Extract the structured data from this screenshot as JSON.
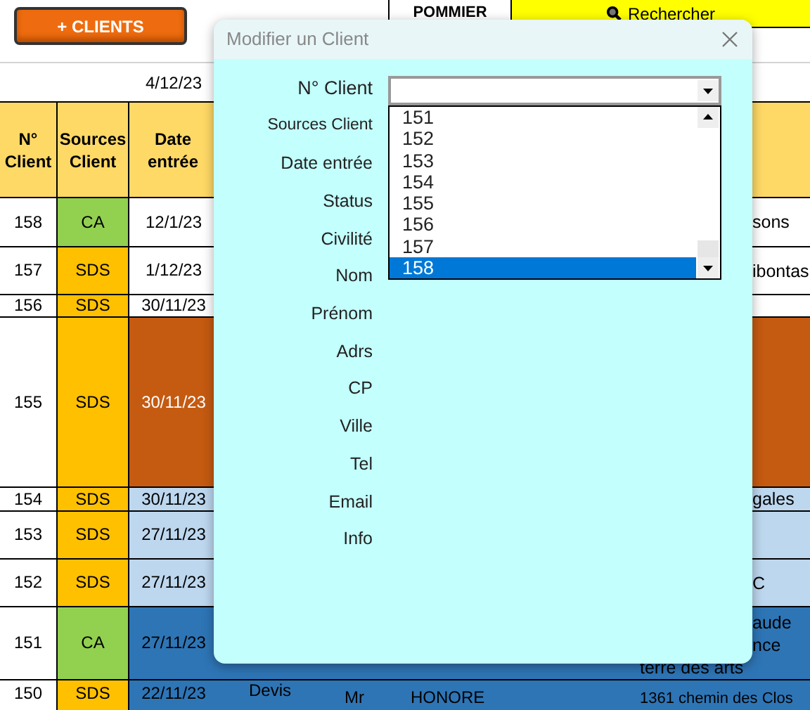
{
  "toolbar": {
    "add_button": "+ CLIENTS",
    "name_cell": "POMMIER",
    "search_button": "Rechercher",
    "date_cell": "4/12/23"
  },
  "columns": [
    "N° Client",
    "Sources Client",
    "Date entrée"
  ],
  "rows": [
    {
      "id": "158",
      "source": {
        "label": "CA",
        "color": "#92d050"
      },
      "date": "12/1/23",
      "color": "#ffffff",
      "right_lines": [
        "sons"
      ]
    },
    {
      "id": "157",
      "source": {
        "label": "SDS",
        "color": "#ffc000"
      },
      "date": "1/12/23",
      "color": "#ffffff",
      "right_lines": [
        "ibontas"
      ]
    },
    {
      "id": "156",
      "source": {
        "label": "SDS",
        "color": "#ffc000"
      },
      "date": "30/11/23",
      "color": "#ffffff"
    },
    {
      "id": "155",
      "source": {
        "label": "SDS",
        "color": "#ffc000"
      },
      "date": "30/11/23",
      "color": "#c55a11"
    },
    {
      "id": "154",
      "source": {
        "label": "SDS",
        "color": "#ffc000"
      },
      "date": "30/11/23",
      "color": "#bdd7ee",
      "right_lines": [
        "gales"
      ]
    },
    {
      "id": "153",
      "source": {
        "label": "SDS",
        "color": "#ffc000"
      },
      "date": "27/11/23",
      "color": "#bdd7ee"
    },
    {
      "id": "152",
      "source": {
        "label": "SDS",
        "color": "#ffc000"
      },
      "date": "27/11/23",
      "color": "#bdd7ee",
      "right_lines": [
        "C"
      ]
    },
    {
      "id": "151",
      "source": {
        "label": "CA",
        "color": "#92d050"
      },
      "date": "27/11/23",
      "color": "#2e75b6",
      "right_lines": [
        "aude",
        "nce"
      ],
      "address": "terre des arts"
    },
    {
      "id": "150",
      "source": {
        "label": "SDS",
        "color": "#ffc000"
      },
      "date": "22/11/23",
      "color": "#2e75b6",
      "type": "Devis",
      "civility": "Mr",
      "name": "HONORE",
      "address": "1361 chemin des Clos"
    }
  ],
  "dialog": {
    "title": "Modifier un Client",
    "labels": [
      "N° Client",
      "Sources Client",
      "Date entrée",
      "Status",
      "Civilité",
      "Nom",
      "Prénom",
      "Adrs",
      "CP",
      "Ville",
      "Tel",
      "Email",
      "Info"
    ],
    "client_list": [
      {
        "label": "151",
        "selected": false
      },
      {
        "label": "152",
        "selected": false
      },
      {
        "label": "153",
        "selected": false
      },
      {
        "label": "154",
        "selected": false
      },
      {
        "label": "155",
        "selected": false
      },
      {
        "label": "156",
        "selected": false
      },
      {
        "label": "157",
        "selected": false
      },
      {
        "label": "158",
        "selected": true
      }
    ]
  }
}
